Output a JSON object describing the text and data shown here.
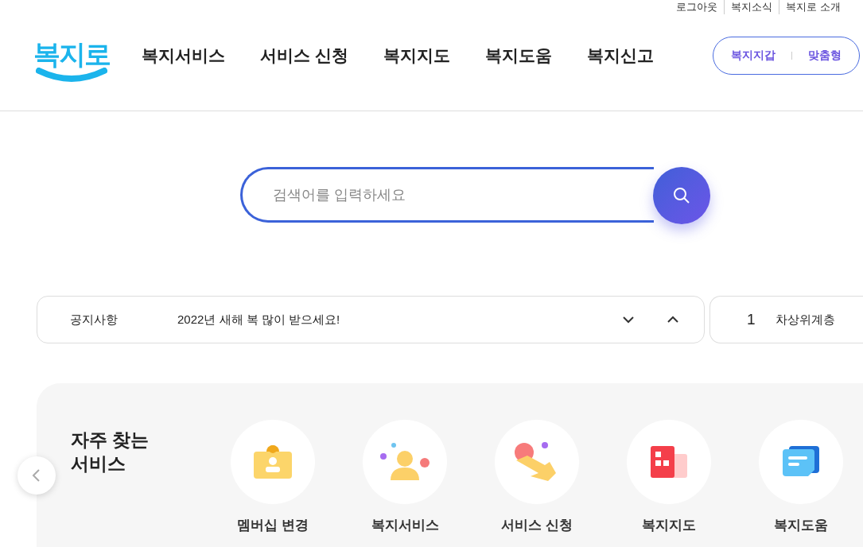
{
  "top_links": [
    "로그아웃",
    "복지소식",
    "복지로 소개"
  ],
  "logo": {
    "text": "복지로"
  },
  "nav": [
    "복지서비스",
    "서비스 신청",
    "복지지도",
    "복지도움",
    "복지신고"
  ],
  "quick_pill": [
    "복지지갑",
    "맞춤형"
  ],
  "search": {
    "placeholder": "검색어를 입력하세요"
  },
  "notice": {
    "label": "공지사항",
    "text": "2022년 새해 복 많이 받으세요!"
  },
  "ranking": {
    "rank": "1",
    "text": "차상위계층"
  },
  "frequent": {
    "title": "자주 찾는\n서비스",
    "items": [
      {
        "kind": "badge",
        "label": "멤버십 변경"
      },
      {
        "kind": "person",
        "label": "복지서비스"
      },
      {
        "kind": "tap",
        "label": "서비스 신청"
      },
      {
        "kind": "map",
        "label": "복지지도"
      },
      {
        "kind": "chat",
        "label": "복지도움"
      }
    ]
  }
}
